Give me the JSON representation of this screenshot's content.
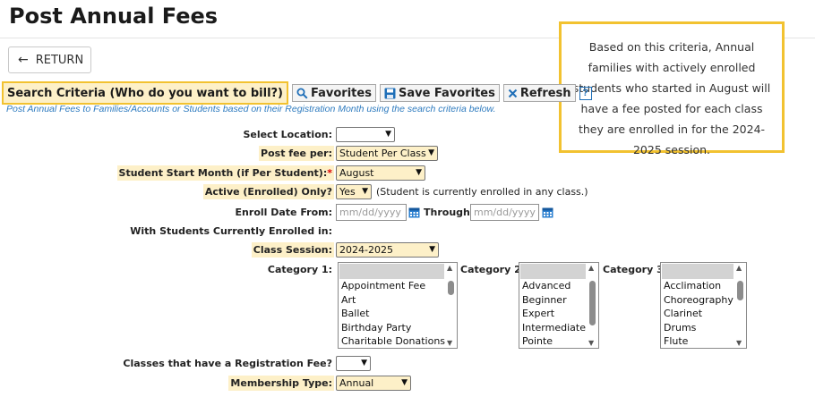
{
  "page": {
    "title": "Post Annual Fees"
  },
  "return_button": {
    "label": "RETURN"
  },
  "callout": {
    "text": "Based on this criteria, Annual families with actively enrolled students who started in August will have a fee posted for each class they are enrolled in for the 2024-2025 session."
  },
  "toolbar": {
    "search_criteria": "Search Criteria (Who do you want to bill?)",
    "favorites": "Favorites",
    "save_favorites": "Save Favorites",
    "refresh": "Refresh",
    "help": "?"
  },
  "subtitle": "Post Annual Fees to Families/Accounts or Students based on their Registration Month using the search criteria below.",
  "form": {
    "select_location": {
      "label": "Select Location:",
      "value": ""
    },
    "post_fee_per": {
      "label": "Post fee per:",
      "value": "Student Per Class"
    },
    "student_start_month": {
      "label": "Student Start Month (if Per Student):",
      "required_mark": "*",
      "value": "August"
    },
    "active_only": {
      "label": "Active (Enrolled) Only?",
      "value": "Yes",
      "note": "(Student is currently enrolled in any class.)"
    },
    "enroll_date": {
      "label": "Enroll Date From:",
      "from_placeholder": "mm/dd/yyyy",
      "through_label": "Through:",
      "through_placeholder": "mm/dd/yyyy"
    },
    "currently_enrolled_heading": "With Students Currently Enrolled in:",
    "class_session": {
      "label": "Class Session:",
      "value": "2024-2025"
    },
    "category1": {
      "label": "Category 1:",
      "options": [
        "Appointment Fee",
        "Art",
        "Ballet",
        "Birthday Party",
        "Charitable Donations"
      ]
    },
    "category2": {
      "label": "Category 2:",
      "options": [
        "Advanced",
        "Beginner",
        "Expert",
        "Intermediate",
        "Pointe"
      ]
    },
    "category3": {
      "label": "Category 3:",
      "options": [
        "Acclimation",
        "Choreography",
        "Clarinet",
        "Drums",
        "Flute"
      ]
    },
    "registration_fee": {
      "label": "Classes that have a Registration Fee?",
      "value": ""
    },
    "membership_type": {
      "label": "Membership Type:",
      "value": "Annual"
    }
  },
  "colors": {
    "highlight": "#fdf0c8",
    "highlight_border": "#f2c230",
    "link_blue": "#2e7bbf",
    "required_red": "#dd0000"
  }
}
